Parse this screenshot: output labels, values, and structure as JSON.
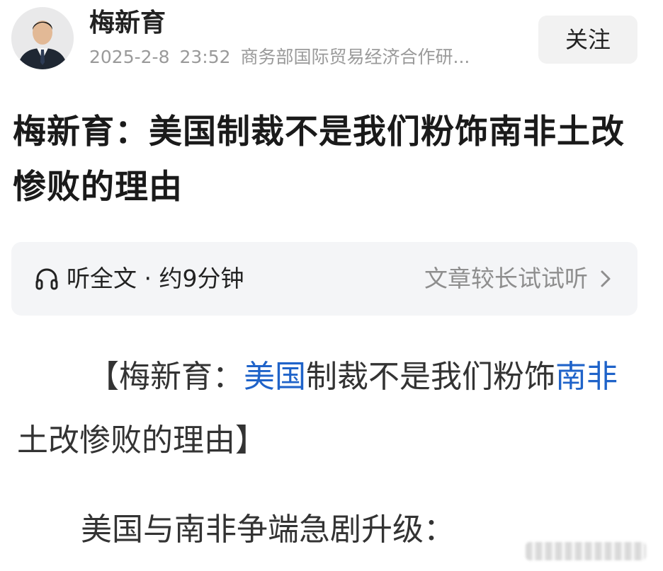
{
  "header": {
    "author_name": "梅新育",
    "date": "2025-2-8",
    "time": "23:52",
    "organization": "商务部国际贸易经济合作研...",
    "follow_label": "关注"
  },
  "article": {
    "title": "梅新育：美国制裁不是我们粉饰南非土改惨败的理由"
  },
  "listen_bar": {
    "icon": "headphone-icon",
    "label": "听全文 · 约9分钟",
    "hint": "文章较长试试听",
    "chevron": "›"
  },
  "body": {
    "p1_open": "【梅新育：",
    "p1_link1": "美国",
    "p1_mid": "制裁不是我们粉饰",
    "p1_link2": "南非",
    "p1_close": "土改惨败的理由】",
    "p2": "美国与南非争端急剧升级："
  },
  "colors": {
    "link": "#1f63c9",
    "muted": "#9a9a9a",
    "button_bg": "#f2f2f2",
    "listen_bg": "#f4f5f7"
  }
}
